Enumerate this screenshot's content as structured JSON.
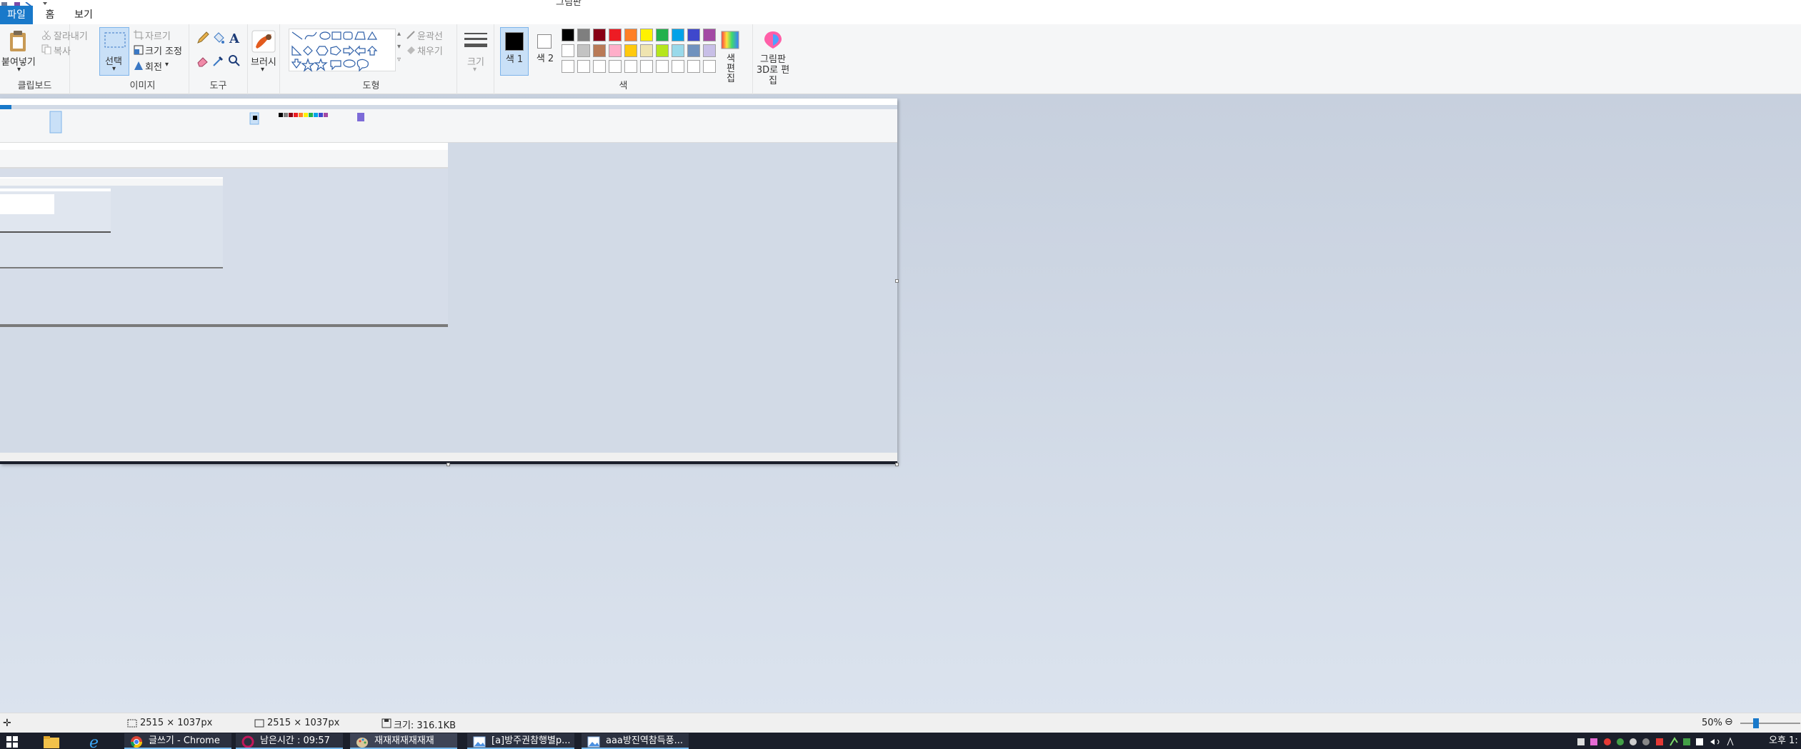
{
  "window": {
    "title": "그림판"
  },
  "tabs": {
    "file": "파일",
    "home": "홈",
    "view": "보기"
  },
  "clipboard": {
    "paste": "붙여넣기",
    "cut": "잘라내기",
    "copy": "복사",
    "group": "클립보드"
  },
  "image": {
    "select": "선택",
    "crop": "자르기",
    "resize": "크기 조정",
    "rotate": "회전",
    "group": "이미지"
  },
  "tools": {
    "group": "도구"
  },
  "brushes": {
    "label": "브러시"
  },
  "shapes": {
    "outline": "윤곽선",
    "fill": "채우기",
    "group": "도형"
  },
  "size": {
    "label": "크기"
  },
  "colors": {
    "color1": "색 1",
    "color2": "색 2",
    "edit": "색 편집",
    "group": "색",
    "palette": [
      "#000000",
      "#7f7f7f",
      "#880015",
      "#ed1c24",
      "#ff7f27",
      "#fff200",
      "#22b14c",
      "#00a2e8",
      "#3f48cc",
      "#a349a4",
      "#ffffff",
      "#c3c3c3",
      "#b97a57",
      "#ffaec9",
      "#ffc90e",
      "#efe4b0",
      "#b5e61d",
      "#99d9ea",
      "#7092be",
      "#c8bfe7"
    ]
  },
  "paint3d": {
    "label": "그림판 3D로 편집"
  },
  "status": {
    "dim1": "2515 × 1037px",
    "dim2": "2515 × 1037px",
    "filesize": "크기: 316.1KB",
    "zoom": "50%"
  },
  "taskbar": {
    "apps": [
      "글쓰기 - Chrome",
      "남은시간 : 09:57",
      "재재재재재재재",
      "[a]방주권참행별p...",
      "aaa방진역참득풍..."
    ],
    "clock": "오후 1:"
  }
}
